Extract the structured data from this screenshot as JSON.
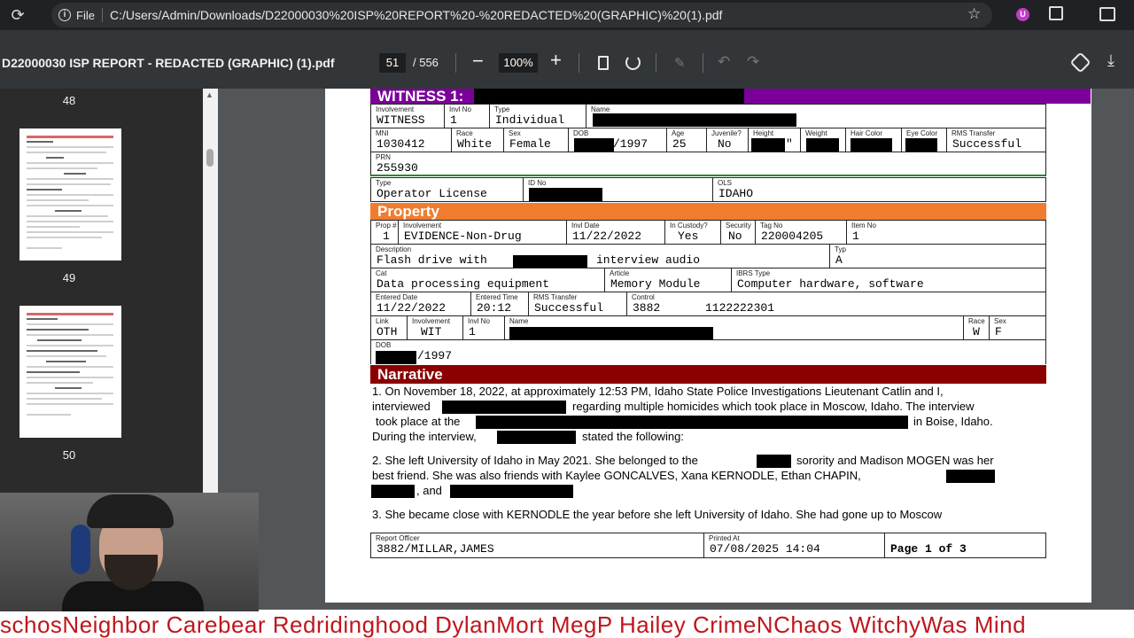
{
  "browser": {
    "file_label": "File",
    "url": "C:/Users/Admin/Downloads/D22000030%20ISP%20REPORT%20-%20REDACTED%20(GRAPHIC)%20(1).pdf",
    "extension_badge": "U"
  },
  "toolbar": {
    "doc_title": "D22000030 ISP REPORT - REDACTED (GRAPHIC) (1).pdf",
    "current_page": "51",
    "total_pages": "/ 556",
    "zoom": "100%",
    "minus": "−",
    "plus": "+"
  },
  "sidebar": {
    "thumbnails": [
      {
        "number": "48"
      },
      {
        "number": "49"
      },
      {
        "number": "50"
      }
    ]
  },
  "witness": {
    "banner": "WITNESS 1:",
    "involvement_label": "Involvement",
    "involvement": "WITNESS",
    "invl_no_label": "Invl No",
    "invl_no": "1",
    "type_label": "Type",
    "type": "Individual",
    "name_label": "Name",
    "mni_label": "MNI",
    "mni": "1030412",
    "race_label": "Race",
    "race": "White",
    "sex_label": "Sex",
    "sex": "Female",
    "dob_label": "DOB",
    "dob": "/1997",
    "age_label": "Age",
    "age": "25",
    "juvenile_label": "Juvenile?",
    "juvenile": "No",
    "height_label": "Height",
    "height_suffix": "\"",
    "weight_label": "Weight",
    "hair_label": "Hair Color",
    "eye_label": "Eye Color",
    "rms_label": "RMS Transfer",
    "rms": "Successful",
    "prn_label": "PRN",
    "prn": "255930",
    "id_type_label": "Type",
    "id_type": "Operator License",
    "id_no_label": "ID No",
    "ols_label": "OLS",
    "ols": "IDAHO"
  },
  "property": {
    "banner": "Property",
    "prop_label": "Prop #",
    "prop": "1",
    "involvement_label": "Involvement",
    "involvement": "EVIDENCE-Non-Drug",
    "invl_date_label": "Invl Date",
    "invl_date": "11/22/2022",
    "custody_label": "In Custody?",
    "custody": "Yes",
    "security_label": "Security",
    "security": "No",
    "tag_label": "Tag No",
    "tag": "220004205",
    "item_label": "Item No",
    "item": "1",
    "desc_label": "Description",
    "desc_a": "Flash drive with",
    "desc_b": "interview audio",
    "typ_label": "Typ",
    "typ": "A",
    "cat_label": "Cat",
    "cat": "Data processing equipment",
    "article_label": "Article",
    "article": "Memory Module",
    "ibrs_label": "IBRS Type",
    "ibrs": "Computer hardware, software",
    "entered_date_label": "Entered Date",
    "entered_date": "11/22/2022",
    "entered_time_label": "Entered Time",
    "entered_time": "20:12",
    "rms_label": "RMS Transfer",
    "rms": "Successful",
    "control_label": "Control",
    "control_a": "3882",
    "control_b": "1122222301",
    "link_label": "Link",
    "link": "OTH",
    "link_inv_label": "Involvement",
    "link_inv": "WIT",
    "link_invl_no_label": "Invl No",
    "link_invl_no": "1",
    "link_name_label": "Name",
    "link_race_label": "Race",
    "link_race": "W",
    "link_sex_label": "Sex",
    "link_sex": "F",
    "link_dob_label": "DOB",
    "link_dob": "/1997"
  },
  "narrative": {
    "banner": "Narrative",
    "p1_l1": "1. On November 18, 2022, at approximately 12:53 PM, Idaho State Police Investigations Lieutenant Catlin and I,",
    "p1_l2a": "interviewed",
    "p1_l2b": "regarding multiple homicides which took place in Moscow, Idaho.  The interview",
    "p1_l3a": "took place at the",
    "p1_l3b": "in Boise, Idaho.",
    "p1_l4a": "During the interview,",
    "p1_l4b": "stated the following:",
    "p2_l1a": "2. She left University of Idaho in May 2021.  She belonged to the",
    "p2_l1b": "sorority and Madison MOGEN was her",
    "p2_l2": "best friend.  She was also friends with Kaylee GONCALVES, Xana KERNODLE, Ethan CHAPIN,",
    "p2_l3": ", and",
    "p3_l1": "3. She became close with KERNODLE the year before she left University of Idaho.  She had gone up to Moscow"
  },
  "footer": {
    "officer_label": "Report Officer",
    "officer": "3882/MILLAR,JAMES",
    "printed_label": "Printed At",
    "printed": "07/08/2025 14:04",
    "page": "Page 1 of 3"
  },
  "ticker": {
    "text": "schosNeighbor  Carebear  Redridinghood  DylanMort  MegP  Hailey  CrimeNChaos  WitchyWas  Mind"
  },
  "colors": {
    "witness_banner": "#7a0099",
    "property_banner": "#f07c30",
    "narrative_banner": "#8b0000",
    "ticker_text": "#c0161d"
  }
}
